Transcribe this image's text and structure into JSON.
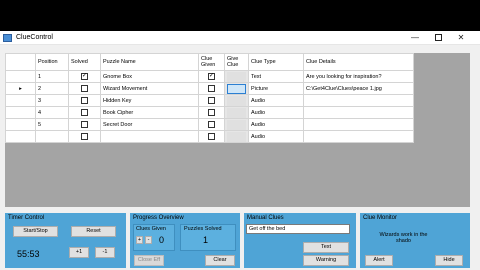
{
  "window": {
    "title": "ClueControl",
    "minimize": "—",
    "close": "✕"
  },
  "grid": {
    "columns": [
      "Position",
      "Solved",
      "Puzzle Name",
      "Clue Given",
      "Give Clue",
      "Clue Type",
      "Clue Details"
    ],
    "current_row_marker": "▸",
    "rows": [
      {
        "position": "1",
        "solved": true,
        "name": "Gnome Box",
        "clue_given": true,
        "type": "Text",
        "details": "Are you looking for inspiration?"
      },
      {
        "position": "2",
        "solved": false,
        "name": "Wizard Movement",
        "clue_given": false,
        "type": "Picture",
        "details": "C:\\Get4Clue\\Clues\\peace 1.jpg"
      },
      {
        "position": "3",
        "solved": false,
        "name": "Hidden Key",
        "clue_given": false,
        "type": "Audio",
        "details": ""
      },
      {
        "position": "4",
        "solved": false,
        "name": "Book Cipher",
        "clue_given": false,
        "type": "Audio",
        "details": ""
      },
      {
        "position": "5",
        "solved": false,
        "name": "Secret Door",
        "clue_given": false,
        "type": "Audio",
        "details": ""
      },
      {
        "position": "",
        "solved": false,
        "name": "",
        "clue_given": false,
        "type": "Audio",
        "details": ""
      }
    ]
  },
  "timer": {
    "title": "Timer Control",
    "start_stop": "Start/Stop",
    "reset": "Reset",
    "time": "55:53",
    "plus": "+1",
    "minus": "-1"
  },
  "progress": {
    "title": "Progress Overview",
    "clues_given_label": "Clues Given",
    "clues_given": "0",
    "puzzles_solved_label": "Puzzles Solved",
    "puzzles_solved": "1",
    "plus": "+",
    "minus": "-",
    "close_eff": "Close Eff",
    "clear": "Clear"
  },
  "manual": {
    "title": "Manual Clues",
    "input_value": "Get off the bed",
    "text_btn": "Text",
    "warning_btn": "Warning"
  },
  "monitor": {
    "title": "Clue Monitor",
    "message": "Wizards work in the shado",
    "alert": "Alert",
    "hide": "Hide"
  }
}
